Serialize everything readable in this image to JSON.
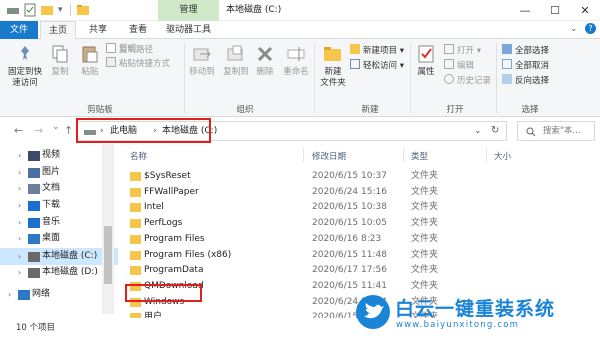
{
  "window": {
    "context_tab": "管理",
    "title": "本地磁盘 (C:)",
    "minimize": "—",
    "maximize": "☐",
    "close": "✕"
  },
  "tabs": [
    "文件",
    "主页",
    "共享",
    "查看",
    "驱动器工具"
  ],
  "ribbon": {
    "clipboard": {
      "pin": "固定到快",
      "pin2": "速访问",
      "copy": "复制",
      "paste": "粘贴",
      "copy_path": "复制路径",
      "paste_shortcut": "粘贴快捷方式",
      "cut": "剪切",
      "label": "剪贴板"
    },
    "organize": {
      "move_to": "移动到",
      "copy_to": "复制到",
      "delete": "删除",
      "rename": "重命名",
      "label": "组织"
    },
    "new": {
      "new_folder": "新建",
      "new_folder2": "文件夹",
      "new_item": "新建项目",
      "easy_access": "轻松访问",
      "label": "新建"
    },
    "open": {
      "properties": "属性",
      "open": "打开",
      "edit": "编辑",
      "history": "历史记录",
      "label": "打开"
    },
    "select": {
      "select_all": "全部选择",
      "select_none": "全部取消",
      "invert": "反向选择",
      "label": "选择"
    }
  },
  "address": {
    "back": "←",
    "forward": "→",
    "recent": "⌄",
    "up": "↑",
    "crumbs": [
      "此电脑",
      "本地磁盘 (C:)"
    ],
    "refresh": "↻",
    "search_placeholder": "搜索\"本...",
    "dropdown": "⌄"
  },
  "sidebar": [
    {
      "label": "视频",
      "icon": "video-icon",
      "color": "#3a4a6a"
    },
    {
      "label": "图片",
      "icon": "pictures-icon",
      "color": "#4a6fa0"
    },
    {
      "label": "文档",
      "icon": "documents-icon",
      "color": "#6d7f99"
    },
    {
      "label": "下载",
      "icon": "download-icon",
      "color": "#1b6fd1"
    },
    {
      "label": "音乐",
      "icon": "music-icon",
      "color": "#1b6fd1"
    },
    {
      "label": "桌面",
      "icon": "desktop-icon",
      "color": "#2f78c4"
    },
    {
      "label": "本地磁盘 (C:)",
      "icon": "drive-icon",
      "color": "#6a6a6a"
    },
    {
      "label": "本地磁盘 (D:)",
      "icon": "drive-icon",
      "color": "#6a6a6a"
    },
    {
      "label": "网络",
      "icon": "network-icon",
      "color": "#2f78c4"
    }
  ],
  "columns": {
    "name": "名称",
    "date": "修改日期",
    "type": "类型",
    "size": "大小"
  },
  "files": [
    {
      "name": "$SysReset",
      "date": "2020/6/15 10:37",
      "type": "文件夹"
    },
    {
      "name": "FFWallPaper",
      "date": "2020/6/24 15:16",
      "type": "文件夹"
    },
    {
      "name": "Intel",
      "date": "2020/6/15 10:38",
      "type": "文件夹"
    },
    {
      "name": "PerfLogs",
      "date": "2020/6/15 10:05",
      "type": "文件夹"
    },
    {
      "name": "Program Files",
      "date": "2020/6/16 8:23",
      "type": "文件夹"
    },
    {
      "name": "Program Files (x86)",
      "date": "2020/6/15 11:48",
      "type": "文件夹"
    },
    {
      "name": "ProgramData",
      "date": "2020/6/17 17:56",
      "type": "文件夹"
    },
    {
      "name": "QMDownload",
      "date": "2020/6/15 11:41",
      "type": "文件夹"
    },
    {
      "name": "Windows",
      "date": "2020/6/24 16:14",
      "type": "文件夹"
    },
    {
      "name": "用户",
      "date": "2020/6/15 10:41",
      "type": "文件夹"
    }
  ],
  "status": {
    "count": "10 个项目"
  },
  "watermark": {
    "brand": "白云一键重装系统",
    "url": "www.baiyunxitong.com"
  },
  "colors": {
    "accent": "#1979ca",
    "highlight": "#e0201c",
    "selected": "#cce8ff",
    "folder": "#f5c64a"
  }
}
